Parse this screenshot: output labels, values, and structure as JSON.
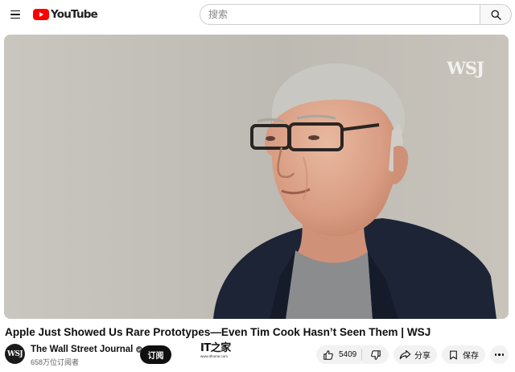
{
  "header": {
    "logo_text": "YouTube",
    "search_placeholder": "搜索",
    "search_value": ""
  },
  "player": {
    "watermark": "WSJ"
  },
  "video": {
    "title": "Apple Just Showed Us Rare Prototypes—Even Tim Cook Hasn’t Seen Them | WSJ"
  },
  "owner": {
    "avatar_text": "WSJ",
    "channel_name": "The Wall Street Journal",
    "subscriber_count": "658万位订阅者",
    "subscribe_label": "订阅"
  },
  "watermark_logo": {
    "text": "IT之家",
    "url": "www.ithome.com"
  },
  "actions": {
    "like_count": "5409",
    "share_label": "分享",
    "save_label": "保存"
  },
  "colors": {
    "brand_red": "#ff0000",
    "button_bg": "#f2f2f2",
    "subscribe_bg": "#0f0f0f"
  }
}
